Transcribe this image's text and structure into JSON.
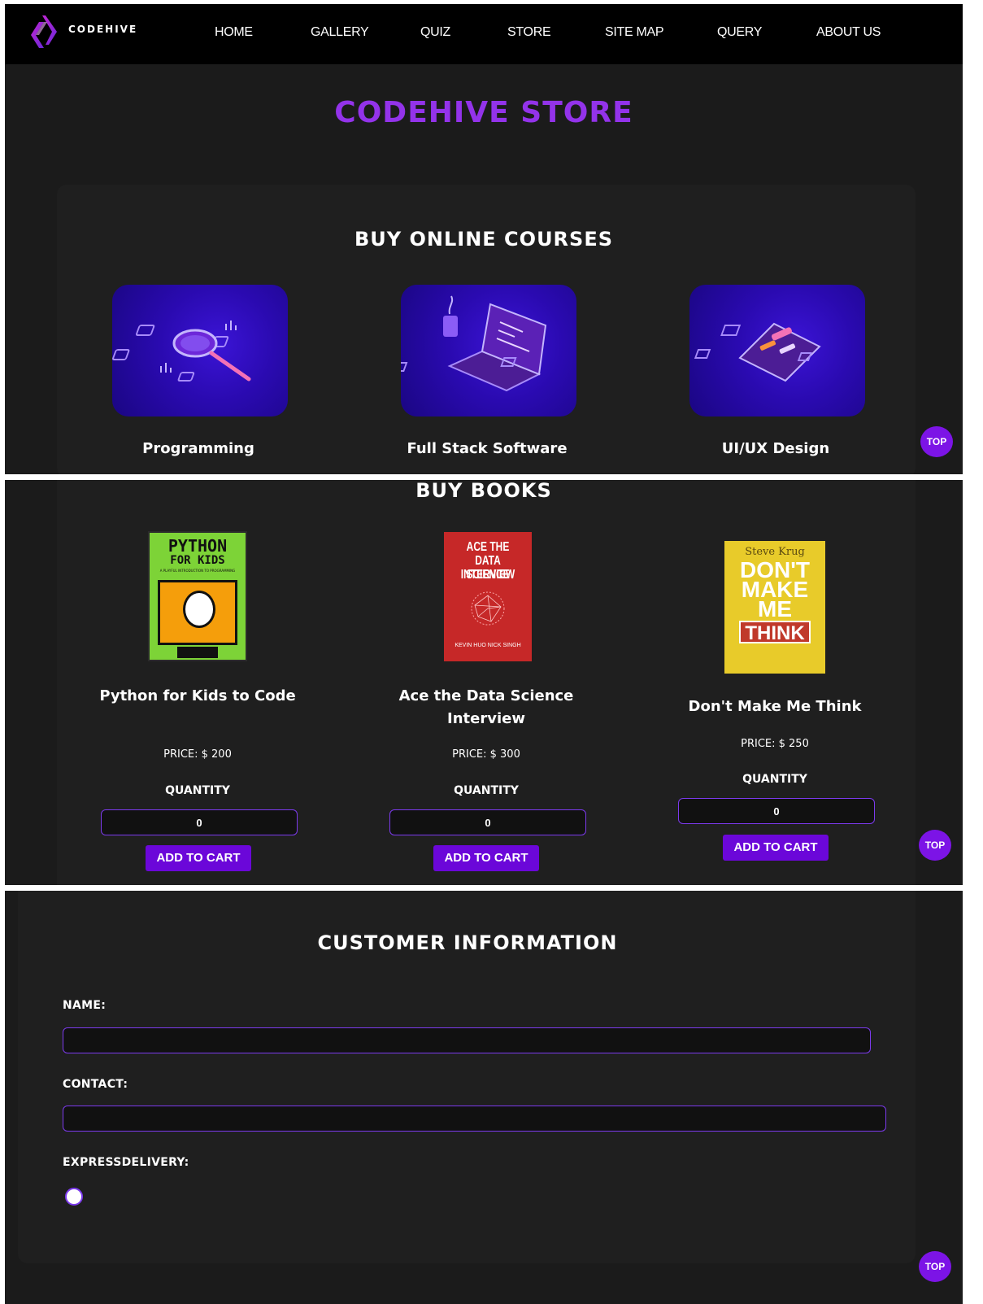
{
  "brand": {
    "name": "CODEHIVE"
  },
  "nav": [
    {
      "label": "HOME"
    },
    {
      "label": "GALLERY"
    },
    {
      "label": "QUIZ"
    },
    {
      "label": "STORE"
    },
    {
      "label": "SITE MAP"
    },
    {
      "label": "QUERY"
    },
    {
      "label": "ABOUT US"
    }
  ],
  "page_title": "CODEHIVE STORE",
  "courses": {
    "heading": "BUY ONLINE COURSES",
    "items": [
      {
        "name": "Programming",
        "icon": "magnifier-data-icon"
      },
      {
        "name": "Full Stack Software",
        "icon": "laptop-code-icon"
      },
      {
        "name": "UI/UX Design",
        "icon": "phone-ui-icon"
      }
    ]
  },
  "books": {
    "heading": "BUY BOOKS",
    "quantity_label": "QUANTITY",
    "add_label": "ADD TO CART",
    "items": [
      {
        "title": "Python for Kids to Code",
        "price": "PRICE: $ 200",
        "quantity": "0",
        "cover": {
          "line1": "PYTHON",
          "line2": "FOR KIDS",
          "subtitle": "A PLAYFUL INTRODUCTION TO PROGRAMMING"
        }
      },
      {
        "title": "Ace the Data Science Interview",
        "price": "PRICE: $ 300",
        "quantity": "0",
        "cover": {
          "line1": "ACE THE",
          "line2": "DATA SCIENCE",
          "line3": "INTERVIEW",
          "authors": "KEVIN HUO   NICK SINGH"
        }
      },
      {
        "title": "Don't Make Me Think",
        "price": "PRICE: $ 250",
        "quantity": "0",
        "cover": {
          "author": "Steve Krug",
          "line1": "DON'T",
          "line2": "MAKE",
          "line3": "ME",
          "line4": "THINK"
        }
      }
    ]
  },
  "customer": {
    "heading": "CUSTOMER INFORMATION",
    "name_label": "NAME:",
    "contact_label": "CONTACT:",
    "express_label": "EXPRESSDELIVERY:"
  },
  "top_button": "TOP",
  "colors": {
    "accent": "#9333ea",
    "button": "#6b07d9",
    "background": "#1b1b1b",
    "nav": "#000000"
  }
}
